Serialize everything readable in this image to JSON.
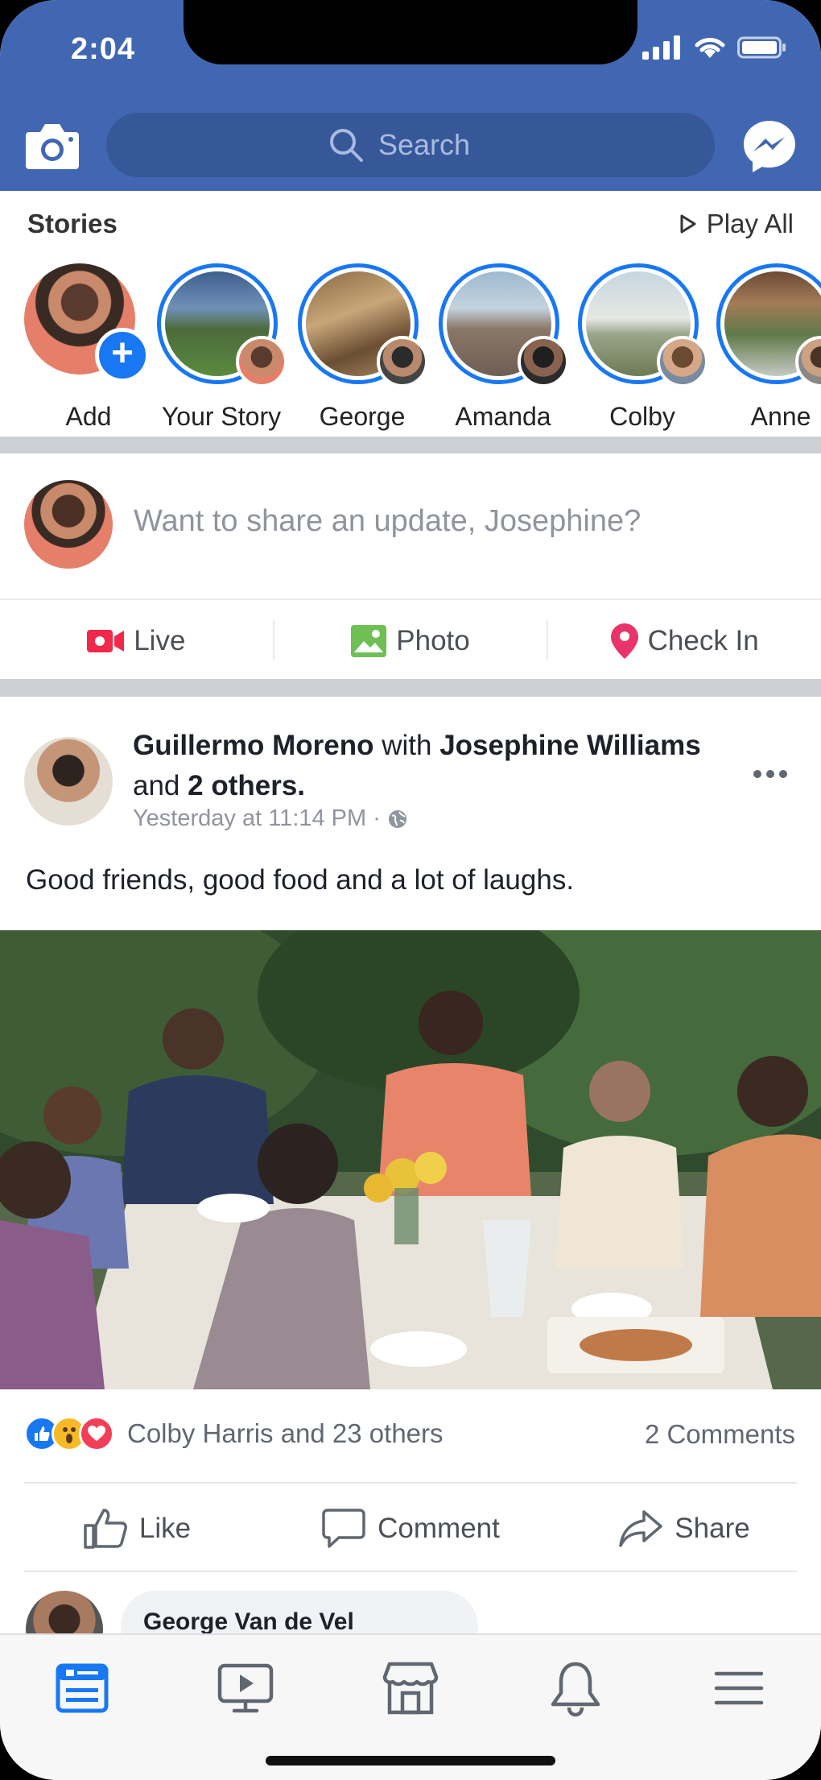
{
  "status_bar": {
    "time": "2:04"
  },
  "header": {
    "search_placeholder": "Search"
  },
  "stories": {
    "title": "Stories",
    "play_all": "Play All",
    "items": [
      {
        "name": "Add"
      },
      {
        "name": "Your Story"
      },
      {
        "name": "George"
      },
      {
        "name": "Amanda"
      },
      {
        "name": "Colby"
      },
      {
        "name": "Anne"
      }
    ]
  },
  "composer": {
    "placeholder": "Want to share an update, Josephine?",
    "actions": [
      {
        "label": "Live",
        "icon": "live-video-icon"
      },
      {
        "label": "Photo",
        "icon": "photo-icon"
      },
      {
        "label": "Check In",
        "icon": "location-pin-icon"
      }
    ]
  },
  "post": {
    "author": "Guillermo Moreno",
    "with_word": "with",
    "tagged": "Josephine Williams",
    "and_word": "and",
    "others": "2 others.",
    "timestamp": "Yesterday at 11:14 PM",
    "separator": "·",
    "text": "Good friends, good food and a lot of laughs.",
    "reactions_text": "Colby Harris and 23 others",
    "comments_count": "2 Comments",
    "actions": [
      {
        "label": "Like"
      },
      {
        "label": "Comment"
      },
      {
        "label": "Share"
      }
    ],
    "comment_preview": {
      "name": "George Van de Vel"
    }
  },
  "tabbar": {
    "items": [
      "news-feed-icon",
      "watch-icon",
      "marketplace-icon",
      "notifications-icon",
      "menu-icon"
    ]
  },
  "colors": {
    "brand_blue": "#4267b2",
    "accent_blue": "#1877f2",
    "live_red": "#f02849",
    "photo_green": "#45bd62",
    "checkin_pink": "#f5533d"
  }
}
